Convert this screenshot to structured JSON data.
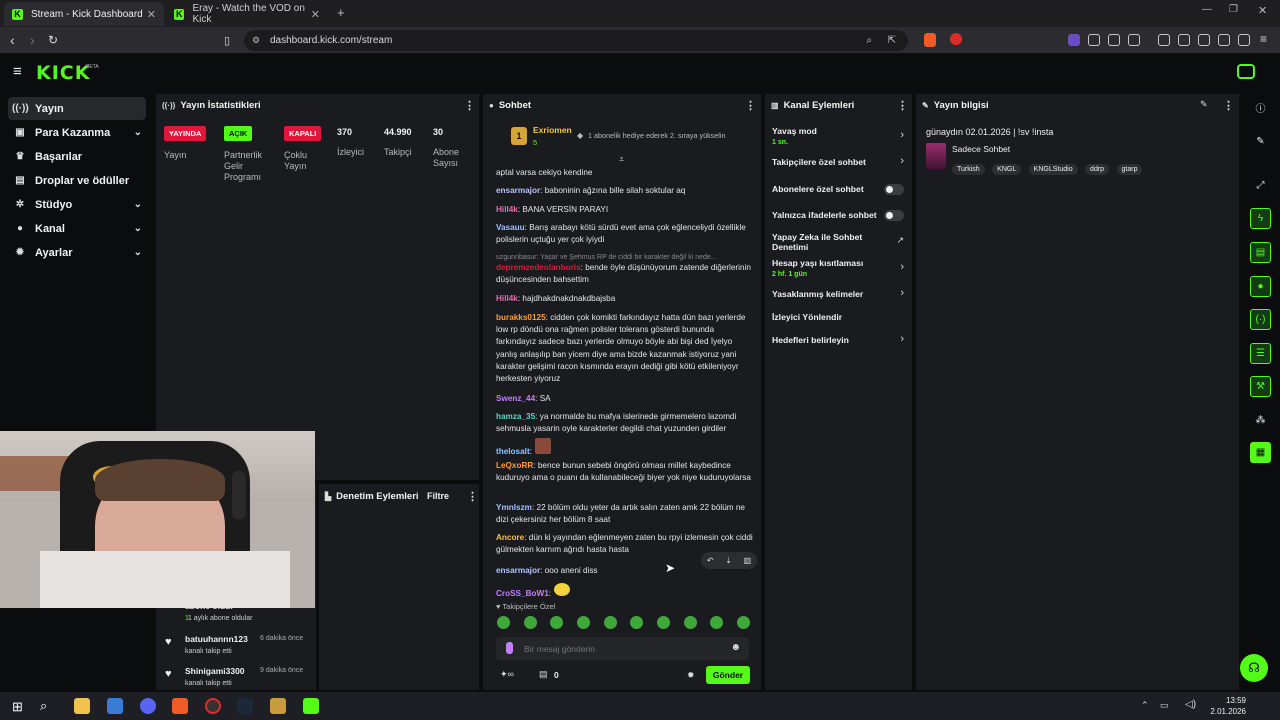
{
  "browser": {
    "tabs": [
      {
        "label": "Stream - Kick Dashboard",
        "active": true
      },
      {
        "label": "Eray - Watch the VOD on Kick",
        "active": false
      }
    ],
    "url": "dashboard.kick.com/stream"
  },
  "brand": {
    "logo": "KICK",
    "beta": "BETA",
    "accent": "#53fc18"
  },
  "sidebar": {
    "items": [
      {
        "label": "Yayın",
        "icon": "broadcast-icon",
        "selected": true
      },
      {
        "label": "Para Kazanma",
        "icon": "dollar-icon",
        "chevron": true
      },
      {
        "label": "Başarılar",
        "icon": "trophy-icon"
      },
      {
        "label": "Droplar ve ödüller",
        "icon": "gift-icon"
      },
      {
        "label": "Stüdyo",
        "icon": "gear-icon",
        "chevron": true
      },
      {
        "label": "Kanal",
        "icon": "person-icon",
        "chevron": true
      },
      {
        "label": "Ayarlar",
        "icon": "settings-icon",
        "chevron": true
      }
    ]
  },
  "stats": {
    "title": "Yayın İstatistikleri",
    "items": [
      {
        "badge": "YAYINDA",
        "badge_color": "#e0163b",
        "label": "Yayın"
      },
      {
        "badge": "AÇIK",
        "badge_color": "#53fc18",
        "label": "Partnerlik Gelir Programı"
      },
      {
        "badge": "KAPALI",
        "badge_color": "#e0163b",
        "label": "Çoklu Yayın"
      },
      {
        "value": "370",
        "label": "İzleyici"
      },
      {
        "value": "44.990",
        "label": "Takipçi"
      },
      {
        "value": "30",
        "label": "Abone Sayısı"
      }
    ]
  },
  "moderation": {
    "title": "Denetim Eylemleri",
    "filter": "Filtre"
  },
  "activity": [
    {
      "user": "abone oldu.",
      "desc": "1 aylık abone oldular",
      "time": ""
    },
    {
      "user": "batuuhannn123",
      "desc": "kanalı takip etti",
      "time": "6 dakika önce"
    },
    {
      "user": "Shinigami3300",
      "desc": "kanalı takip etti",
      "time": "9 dakika önce"
    }
  ],
  "chat": {
    "title": "Sohbet",
    "pinned": {
      "user": "Exriomen",
      "rank": "1",
      "count": "5",
      "text": "1 abonelik hediye ederek 2. sıraya yükselin"
    },
    "messages": [
      {
        "user": "",
        "color": "#e6e6e6",
        "text": "aptal varsa cekiyo kendine"
      },
      {
        "user": "ensarmajor",
        "color": "#b7c0ff",
        "text": "baboninin ağzına bille silah soktular aq"
      },
      {
        "user": "Hill4k",
        "color": "#e86fae",
        "text": "BANA VERSİN PARAYI"
      },
      {
        "user": "Vasauu",
        "color": "#9ec2ff",
        "text": "Barış arabayı kötü sürdü evet ama çok eğlenceliydi özellikle polislerin uçtuğu yer çok iyiydi"
      },
      {
        "user": "",
        "color": "#8a8a8a",
        "reply": "uzgunnbasur: Yaşar ve Şehmus RP de ciddi bir karakter değil ki nede...",
        "text": ""
      },
      {
        "user": "depremzedeolanboris",
        "color": "#e0163b",
        "text": "bende öyle düşünüyorum zatende diğerlerinin düşüncesinden bahsettim"
      },
      {
        "user": "Hill4k",
        "color": "#e86fae",
        "text": "hajdhakdnakdnakdbajsba"
      },
      {
        "user": "burakks0125",
        "color": "#ff9a3c",
        "text": "cidden çok komikti farkındayız hatta dün bazı yerlerde low rp döndü ona rağmen polisler tolerans gösterdi bununda farkındayız sadece bazı yerlerde olmuyo böyle abi bişi ded İyelyo yanlış anlaşılıp ban yicem diye ama bizde kazanmak istiyoruz yani karakter gelişimi racon kısmında erayın dediği gibi kötü etkileniyoyr herkesten yiyoruz"
      },
      {
        "user": "Swenz_44",
        "color": "#c77dff",
        "text": "SA"
      },
      {
        "user": "hamza_35",
        "color": "#5fd3c2",
        "text": "ya normalde bu mafya islerinede girmemelero lazomdi sehmusla yasarin oyle karakterler degildi chat yuzunden girdiler"
      },
      {
        "user": "thelosalt",
        "color": "#8cc7ff",
        "text": ""
      },
      {
        "user": "LeQxoRR",
        "color": "#ff9a3c",
        "text": "bence bunun sebebi öngörü olması millet kaybedince kuduruyo ama o puanı da kullanabileceği biyer yok niye kuduruyolarsa"
      },
      {
        "user": "Ymnlszm",
        "color": "#9ec2ff",
        "text": "22 bölüm oldu yeter da artık salın zaten amk 22 bölüm ne dizi çekersiniz her bölüm 8 saat"
      },
      {
        "user": "Ancore",
        "color": "#f5c542",
        "text": "dün ki yayından eğlenmeyen zaten bu rpyi izlemesin çok ciddi gülmekten karnım ağrıdı hasta hasta"
      },
      {
        "user": "ensarmajor",
        "color": "#b7c0ff",
        "text": "ooo aneni diss"
      },
      {
        "user": "CroSS_BoW1",
        "color": "#c77dff",
        "text": ""
      }
    ],
    "followers_only": "Takipçilere Özel",
    "input_placeholder": "Bir mesaj gönderin",
    "points": "0",
    "send_label": "Gönder"
  },
  "channel_actions": {
    "title": "Kanal Eylemleri",
    "items": [
      {
        "label": "Yavaş mod",
        "sub": "1 sn.",
        "control": "chevron"
      },
      {
        "label": "Takipçilere özel sohbet",
        "sub": "",
        "control": "chevron"
      },
      {
        "label": "Abonelere özel sohbet",
        "sub": "",
        "control": "toggle"
      },
      {
        "label": "Yalnızca ifadelerle sohbet",
        "sub": "",
        "control": "toggle"
      },
      {
        "label": "Yapay Zeka ile Sohbet Denetimi",
        "sub": "",
        "control": "external"
      },
      {
        "label": "Hesap yaşı kısıtlaması",
        "sub": "2 hf. 1 gün",
        "control": "chevron"
      },
      {
        "label": "Yasaklanmış kelimeler",
        "sub": "",
        "control": "chevron"
      },
      {
        "label": "İzleyici Yönlendir",
        "sub": "",
        "control": "none"
      },
      {
        "label": "Hedefleri belirleyin",
        "sub": "",
        "control": "chevron"
      }
    ]
  },
  "stream_info": {
    "title": "Yayın bilgisi",
    "stream_title": "günaydın 02.01.2026 | !sv !insta",
    "category": "Sadece Sohbet",
    "tags": [
      "Turkish",
      "KNGL",
      "KNGLStudio",
      "ddrp",
      "gtarp"
    ]
  },
  "taskbar": {
    "time": "13:59",
    "date": "2.01.2026"
  }
}
